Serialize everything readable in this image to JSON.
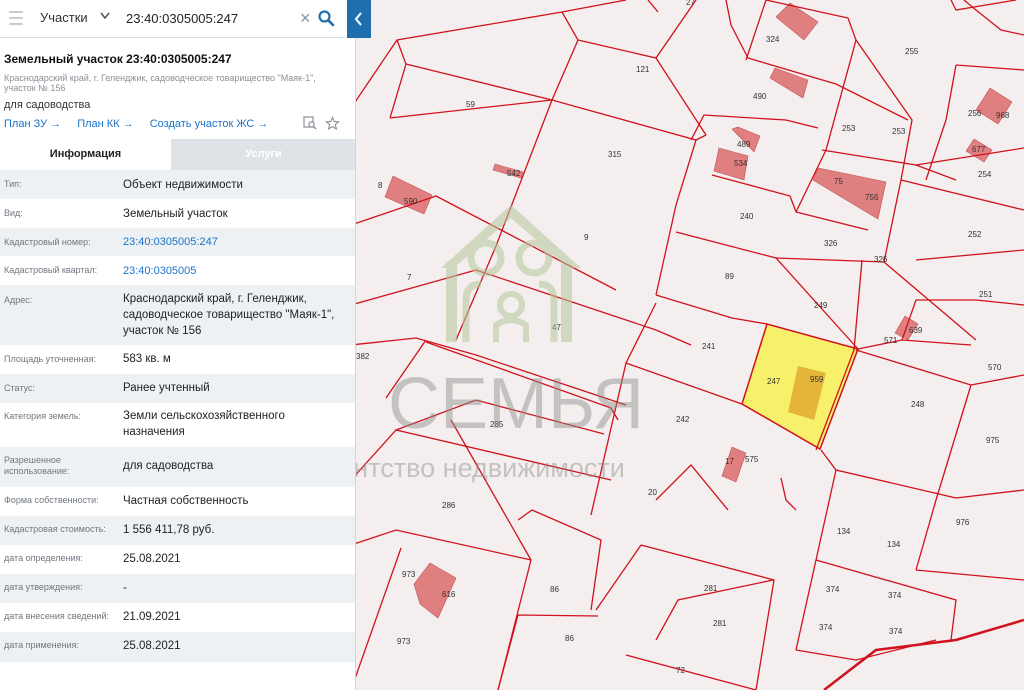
{
  "search": {
    "layer": "Участки",
    "query": "23:40:0305005:247"
  },
  "card": {
    "title": "Земельный участок 23:40:0305005:247",
    "address_line1": "Краснодарский край, г. Геленджик, садоводческое товарищество \"Маяк-1\",",
    "address_line2": "участок № 156",
    "purpose": "для садоводства",
    "links": [
      "План ЗУ",
      "План КК",
      "Создать участок ЖС"
    ]
  },
  "tabs": [
    "Информация",
    "Услуги"
  ],
  "rows": [
    {
      "label": "Тип:",
      "value": "Объект недвижимости"
    },
    {
      "label": "Вид:",
      "value": "Земельный участок"
    },
    {
      "label": "Кадастровый номер:",
      "value": "23:40:0305005:247"
    },
    {
      "label": "Кадастровый квартал:",
      "value": "23:40:0305005"
    },
    {
      "label": "Адрес:",
      "value": "Краснодарский край, г. Геленджик, садоводческое товарищество \"Маяк-1\", участок № 156"
    },
    {
      "label": "Площадь уточненная:",
      "value": "583 кв. м"
    },
    {
      "label": "Статус:",
      "value": "Ранее учтенный"
    },
    {
      "label": "Категория земель:",
      "value": "Земли сельскохозяйственного назначения"
    },
    {
      "label": "Разрешенное использование:",
      "value": "для садоводства"
    },
    {
      "label": "Форма собственности:",
      "value": "Частная собственность"
    },
    {
      "label": "Кадастровая стоимость:",
      "value": "1 556 411,78 руб."
    },
    {
      "label": "дата определения:",
      "value": "25.08.2021"
    },
    {
      "label": "дата утверждения:",
      "value": "-"
    },
    {
      "label": "дата внесения сведений:",
      "value": "21.09.2021"
    },
    {
      "label": "дата применения:",
      "value": "25.08.2021"
    }
  ],
  "map": {
    "plot_labels": [
      "27",
      "324",
      "255",
      "121",
      "59",
      "315",
      "490",
      "253",
      "253",
      "256",
      "968",
      "677",
      "254",
      "8",
      "542",
      "489",
      "534",
      "75",
      "75б",
      "252",
      "590",
      "240",
      "326",
      "326",
      "9",
      "89",
      "7",
      "251",
      "249",
      "639",
      "571",
      "47",
      "241",
      "570",
      "382",
      "247",
      "959",
      "248",
      "242",
      "975",
      "285",
      "17",
      "575",
      "20",
      "286",
      "976",
      "134",
      "134",
      "973",
      "616",
      "86",
      "281",
      "374",
      "374",
      "86",
      "281",
      "374",
      "374",
      "973",
      "72"
    ],
    "building_labels": [
      "634",
      "543",
      "542",
      "534",
      "75б",
      "590",
      "639",
      "575",
      "616",
      "968",
      "677"
    ],
    "colors": {
      "line": "#d0121c",
      "building": "#e07f80",
      "selected": "#f6f06a",
      "selected_building": "#e5b53a",
      "background": "#f4eeee"
    }
  },
  "watermark": {
    "brand": "СЕМЬЯ",
    "tagline": "агентство недвижимости"
  }
}
